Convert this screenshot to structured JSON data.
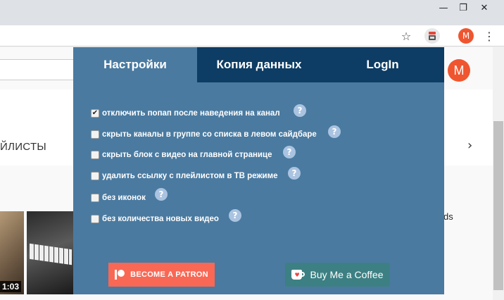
{
  "browser": {
    "window_controls": {
      "minimize": "—",
      "restore": "❐",
      "close": "✕"
    },
    "toolbar": {
      "star_icon": "☆",
      "extension_icon": "patreon-extension",
      "profile_initial": "M",
      "menu_glyph": "⋮"
    }
  },
  "page": {
    "profile_initial": "M",
    "section_label": "ЙЛИСТЫ",
    "chevron": "›",
    "video_duration": "1:03",
    "side_text": "ds"
  },
  "popup": {
    "tabs": [
      {
        "label": "Настройки",
        "active": true
      },
      {
        "label": "Копия данных",
        "active": false
      },
      {
        "label": "LogIn",
        "active": false
      }
    ],
    "options": [
      {
        "label": "отключить попап после наведения на канал",
        "checked": true
      },
      {
        "label": "скрыть каналы в группе со списка в левом сайдбаре",
        "checked": false
      },
      {
        "label": "скрыть блок с видео на главной странице",
        "checked": false
      },
      {
        "label": "удалить ссылку с плейлистом в ТВ режиме",
        "checked": false
      },
      {
        "label": "без иконок",
        "checked": false
      },
      {
        "label": "без количества новых видео",
        "checked": false
      }
    ],
    "help_glyph": "?",
    "check_glyph": "✔",
    "patron_button": "BECOME A PATRON",
    "coffee_button": "Buy Me a Coffee"
  },
  "colors": {
    "popup_bg": "#4a7aa0",
    "tab_bar_bg": "#0d3c64",
    "patron": "#f96854",
    "coffee": "#3d8083",
    "avatar": "#ef5630"
  }
}
